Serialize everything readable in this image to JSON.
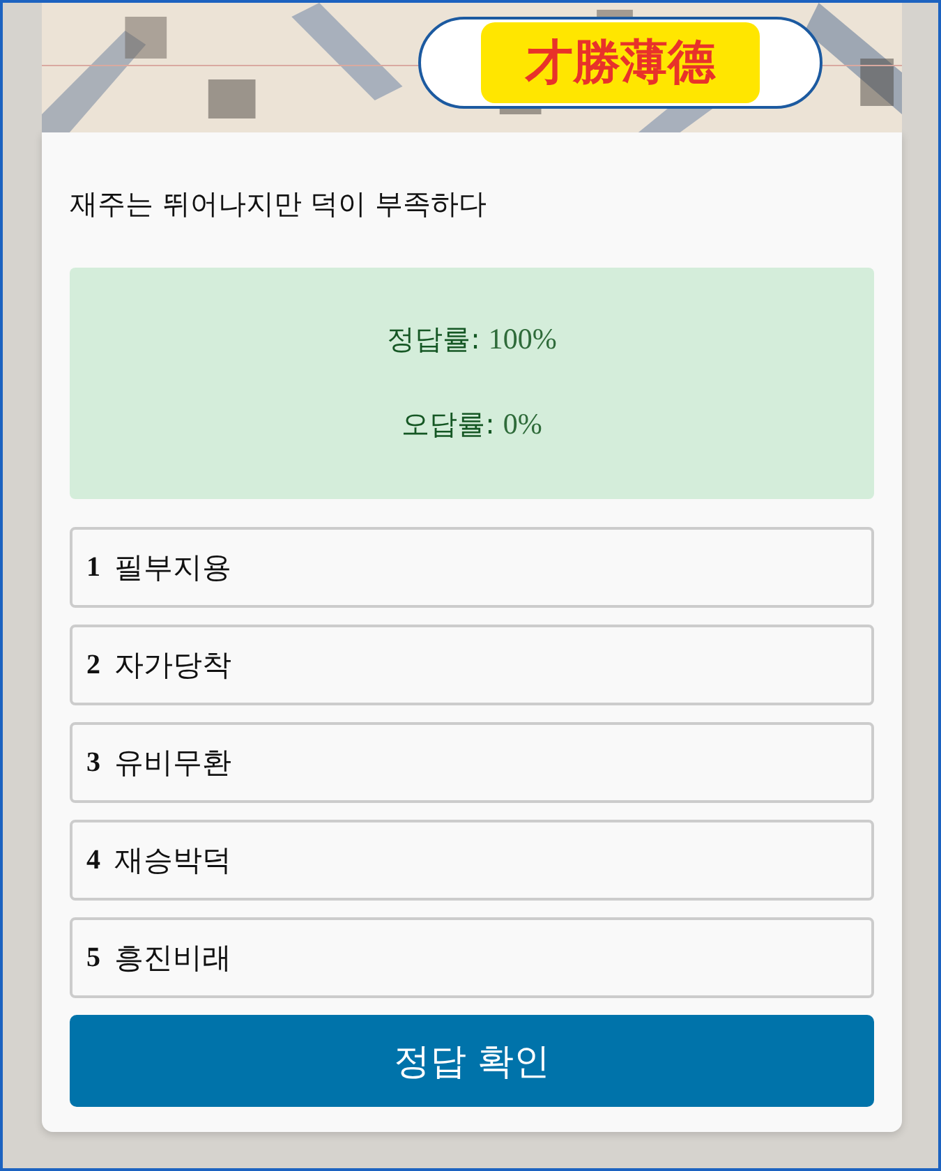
{
  "header": {
    "kind": "picture",
    "badge": "才勝薄德"
  },
  "question": "재주는 뛰어나지만 덕이 부족하다",
  "stats": [
    {
      "label": "정답률:",
      "value": "100%"
    },
    {
      "label": "오답률:",
      "value": "0%"
    }
  ],
  "options": [
    {
      "number": "1",
      "text": "필부지용",
      "selected": false
    },
    {
      "number": "2",
      "text": "자가당착",
      "selected": false
    },
    {
      "number": "3",
      "text": "유비무환",
      "selected": false
    },
    {
      "number": "4",
      "text": "재승박덕",
      "selected": false
    },
    {
      "number": "5",
      "text": "흥진비래",
      "selected": false
    }
  ],
  "submit": "정답 확인"
}
